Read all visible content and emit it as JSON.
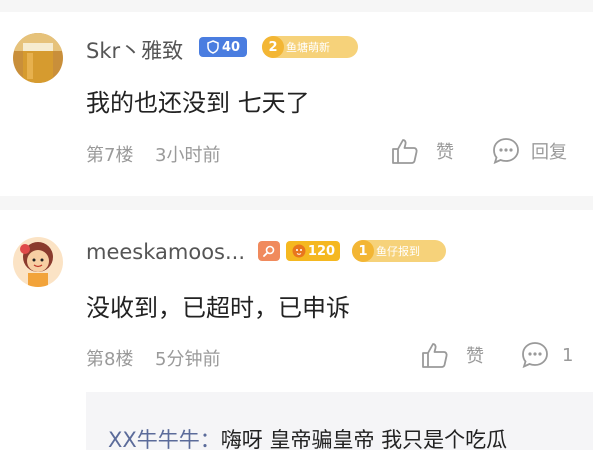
{
  "comments": [
    {
      "username": "Skr丶雅致",
      "level_badge": "40",
      "fan_num": "2",
      "fan_label": "鱼塘萌新",
      "text": "我的也还没到 七天了",
      "floor": "第7楼",
      "time": "3小时前",
      "like_label": "赞",
      "reply_label": "回复"
    },
    {
      "username": "meeskamoos...",
      "level_badge": "120",
      "fan_num": "1",
      "fan_label": "鱼仔报到",
      "text": "没收到，已超时，已申诉",
      "floor": "第8楼",
      "time": "5分钟前",
      "like_label": "赞",
      "reply_count": "1"
    }
  ],
  "quote": {
    "name": "XX牛牛牛",
    "colon": "：",
    "text": "嗨呀 皇帝骗皇帝 我只是个吃瓜"
  },
  "colors": {
    "blue_badge": "#4a7de0",
    "gold_badge": "#f5b820",
    "pill_gold": "#f6c94a",
    "orange_badge": "#f08a5d",
    "meta_gray": "#9a9a9a"
  }
}
